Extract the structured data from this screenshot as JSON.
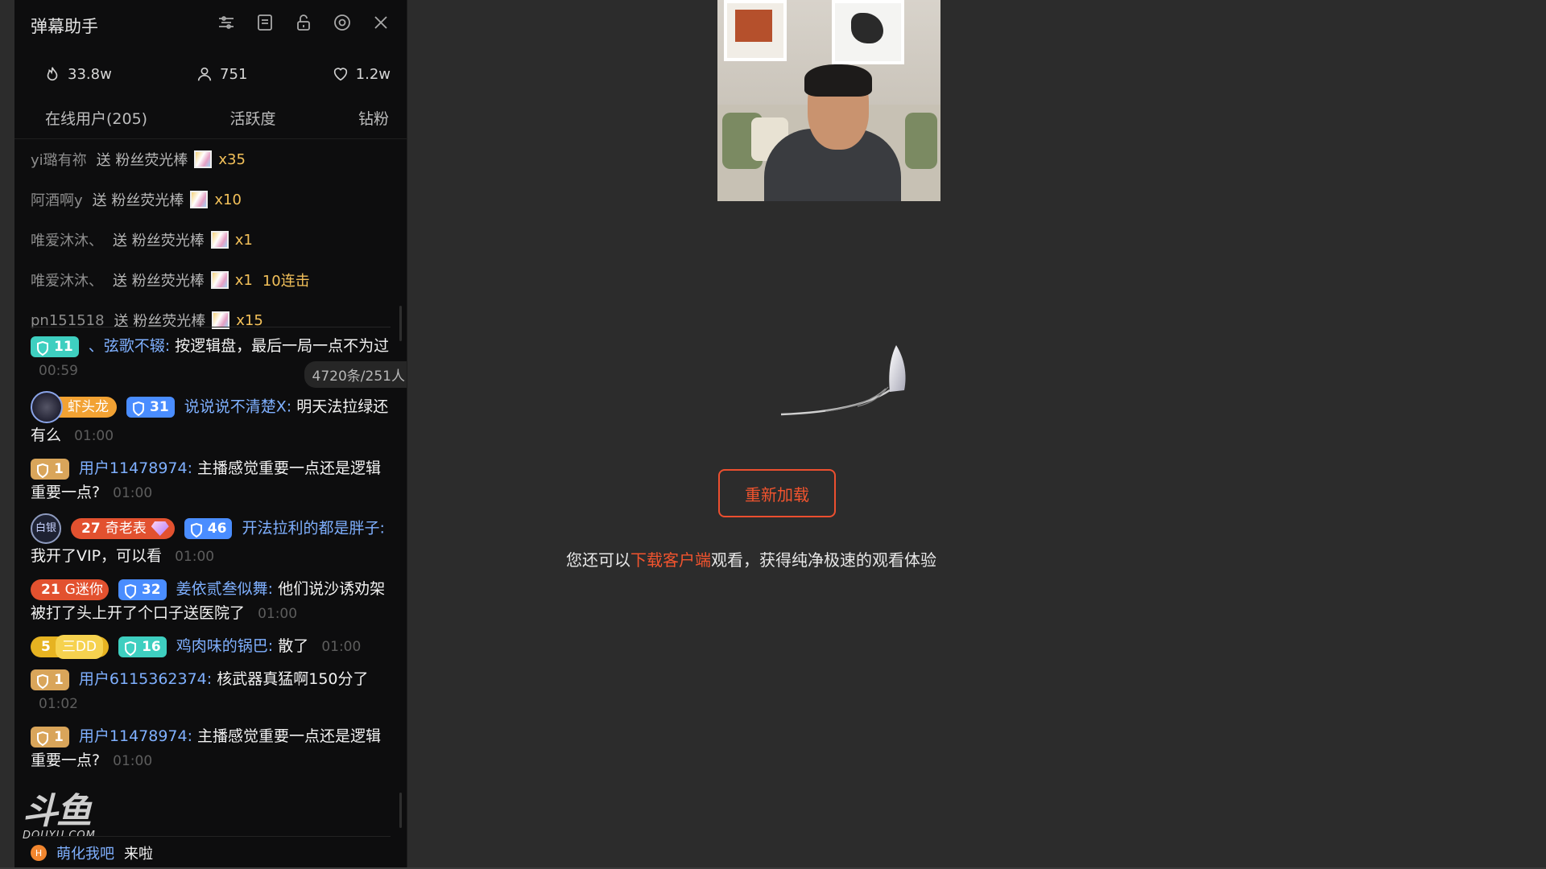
{
  "panel": {
    "title": "弹幕助手",
    "header_icons": [
      "filter-icon",
      "list-icon",
      "lock-icon",
      "settings-icon",
      "close-icon"
    ],
    "stats": {
      "heat": "33.8w",
      "viewers": "751",
      "likes": "1.2w"
    },
    "tabs": [
      "在线用户(205)",
      "活跃度",
      "钻粉"
    ],
    "gifts": [
      {
        "user": "yi璐有祢",
        "verb": "送 粉丝荧光棒",
        "count": "x35",
        "combo": ""
      },
      {
        "user": "阿酒啊y",
        "verb": "送 粉丝荧光棒",
        "count": "x10",
        "combo": ""
      },
      {
        "user": "唯爱沐沐、",
        "verb": "送 粉丝荧光棒",
        "count": "x1",
        "combo": ""
      },
      {
        "user": "唯爱沐沐、",
        "verb": "送 粉丝荧光棒",
        "count": "x1",
        "combo": "10连击"
      },
      {
        "user": "pn151518",
        "verb": "送 粉丝荧光棒",
        "count": "x15",
        "combo": ""
      }
    ],
    "count_pill": "4720条/251人",
    "messages": [
      {
        "badge_level": "11",
        "user": "、弦歌不辍:",
        "text": "按逻辑盘，最后一局一点不为过",
        "time": "00:59"
      },
      {
        "fan_name": "虾头龙",
        "badge_level": "31",
        "user": "说说说不清楚X:",
        "text": "明天法拉绿还有么",
        "time": "01:00"
      },
      {
        "badge_level": "1",
        "user": "用户11478974:",
        "text": "主播感觉重要一点还是逻辑重要一点?",
        "time": "01:00"
      },
      {
        "avatar": "白银",
        "noble_level": "27",
        "noble_name": "奇老表",
        "badge_level": "46",
        "user": "开法拉利的都是胖子:",
        "text": "我开了VIP，可以看",
        "time": "01:00"
      },
      {
        "noble_level": "21",
        "noble_name": "G迷你",
        "badge_level": "32",
        "user": "姜依贰叁似舞:",
        "text": "他们说沙诱劝架被打了头上开了个口子送医院了",
        "time": "01:00"
      },
      {
        "noble_level": "5",
        "noble_name": "三DD",
        "badge_level": "16",
        "user": "鸡肉味的锅巴:",
        "text": "散了",
        "time": "01:00"
      },
      {
        "badge_level": "1",
        "user": "用户6115362374:",
        "text": "核武器真猛啊150分了",
        "time": "01:02"
      },
      {
        "badge_level": "1",
        "user": "用户11478974:",
        "text": "主播感觉重要一点还是逻辑重要一点?",
        "time": "01:00"
      }
    ],
    "entry": {
      "badge": "H",
      "user": "萌化我吧",
      "action": "来啦"
    },
    "watermark": {
      "logo": "斗鱼",
      "domain": "DOUYU.COM"
    }
  },
  "player": {
    "reload_label": "重新加载",
    "download_prefix": "您还可以",
    "download_link": "下载客户端",
    "download_suffix": "观看，获得纯净极速的观看体验"
  },
  "colors": {
    "accent": "#ec4f2f",
    "link_blue": "#7fb0ff",
    "gold": "#f3c15a",
    "panel_bg": "#0d0d0e",
    "page_bg": "#2c2c2c"
  }
}
